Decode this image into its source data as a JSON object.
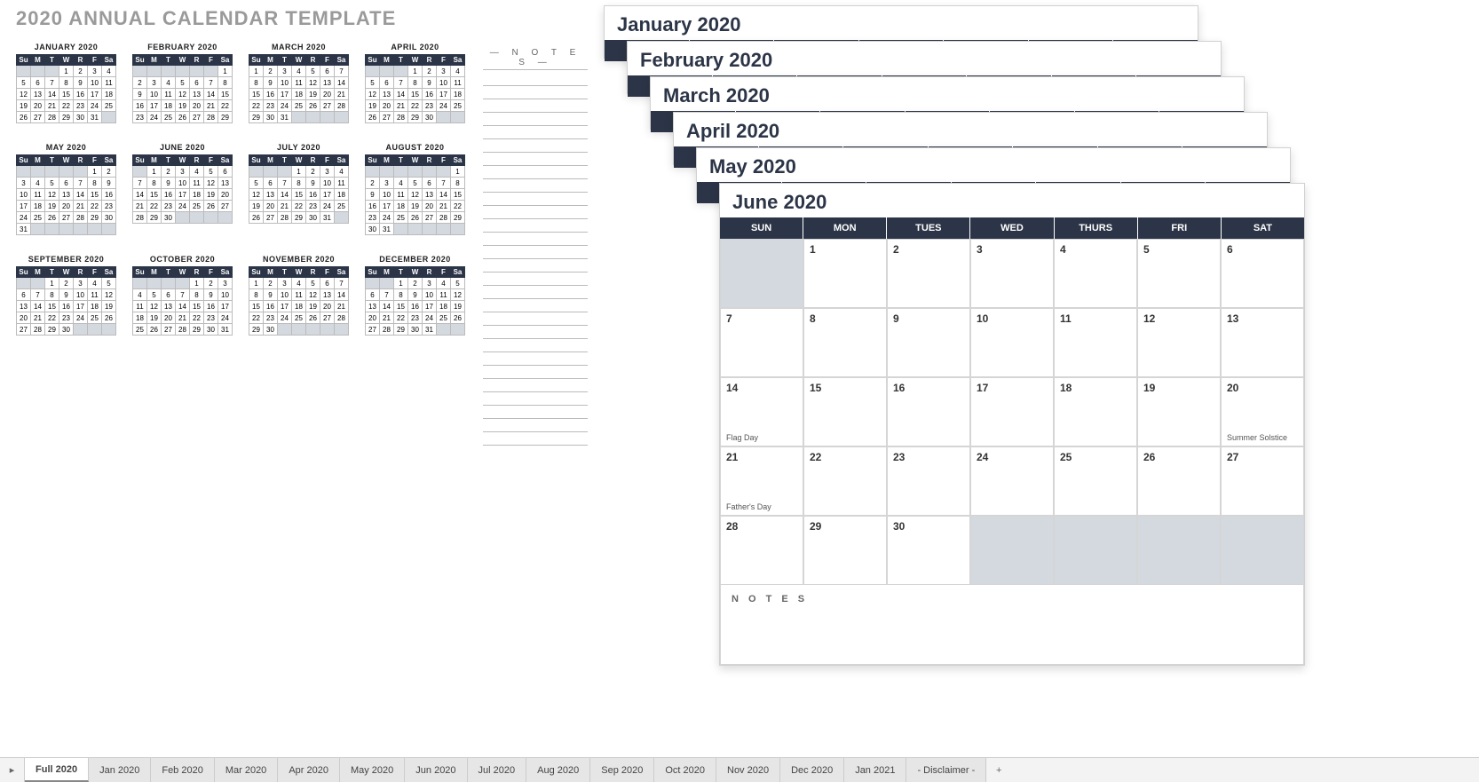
{
  "annual_title": "2020 ANNUAL CALENDAR TEMPLATE",
  "notes_header": "— N O T E S —",
  "big_notes_label": "N O T E S",
  "day_short": [
    "Su",
    "M",
    "T",
    "W",
    "R",
    "F",
    "Sa"
  ],
  "day_big": [
    "SUN",
    "MON",
    "TUES",
    "WED",
    "THURS",
    "FRI",
    "SAT"
  ],
  "mini_months": [
    {
      "title": "JANUARY 2020",
      "start": 3,
      "days": 31
    },
    {
      "title": "FEBRUARY 2020",
      "start": 6,
      "days": 29
    },
    {
      "title": "MARCH 2020",
      "start": 0,
      "days": 31
    },
    {
      "title": "APRIL 2020",
      "start": 3,
      "days": 30
    },
    {
      "title": "MAY 2020",
      "start": 5,
      "days": 31
    },
    {
      "title": "JUNE 2020",
      "start": 1,
      "days": 30
    },
    {
      "title": "JULY 2020",
      "start": 3,
      "days": 31
    },
    {
      "title": "AUGUST 2020",
      "start": 6,
      "days": 31
    },
    {
      "title": "SEPTEMBER 2020",
      "start": 2,
      "days": 30
    },
    {
      "title": "OCTOBER 2020",
      "start": 4,
      "days": 31
    },
    {
      "title": "NOVEMBER 2020",
      "start": 0,
      "days": 30
    },
    {
      "title": "DECEMBER 2020",
      "start": 2,
      "days": 31
    }
  ],
  "stacked_titles": [
    "January 2020",
    "February 2020",
    "March 2020",
    "April 2020",
    "May 2020",
    "June 2020"
  ],
  "big_month": {
    "title": "June 2020",
    "start": 1,
    "days": 30,
    "events": {
      "14": "Flag Day",
      "20": "Summer Solstice",
      "21": "Father's Day"
    }
  },
  "tabs": [
    "Full 2020",
    "Jan 2020",
    "Feb 2020",
    "Mar 2020",
    "Apr 2020",
    "May 2020",
    "Jun 2020",
    "Jul 2020",
    "Aug 2020",
    "Sep 2020",
    "Oct 2020",
    "Nov 2020",
    "Dec 2020",
    "Jan 2021",
    "- Disclaimer -"
  ],
  "active_tab": 0
}
